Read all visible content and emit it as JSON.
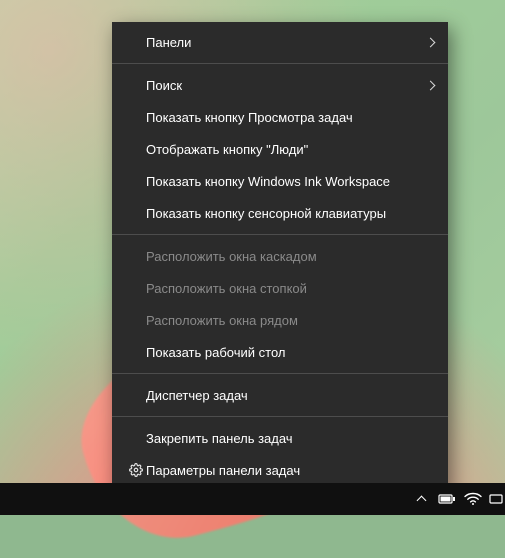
{
  "context_menu": {
    "items": [
      {
        "label": "Панели",
        "submenu": true
      },
      {
        "separator": true
      },
      {
        "label": "Поиск",
        "submenu": true
      },
      {
        "label": "Показать кнопку Просмотра задач"
      },
      {
        "label": "Отображать кнопку \"Люди\""
      },
      {
        "label": "Показать кнопку Windows Ink Workspace"
      },
      {
        "label": "Показать кнопку сенсорной клавиатуры"
      },
      {
        "separator": true
      },
      {
        "label": "Расположить окна каскадом",
        "disabled": true
      },
      {
        "label": "Расположить окна стопкой",
        "disabled": true
      },
      {
        "label": "Расположить окна рядом",
        "disabled": true
      },
      {
        "label": "Показать рабочий стол"
      },
      {
        "separator": true
      },
      {
        "label": "Диспетчер задач"
      },
      {
        "separator": true
      },
      {
        "label": "Закрепить панель задач"
      },
      {
        "label": "Параметры панели задач",
        "icon": "gear"
      }
    ]
  },
  "tray": {
    "icons": [
      "overflow-chevron",
      "battery",
      "wifi",
      "keyboard"
    ]
  }
}
